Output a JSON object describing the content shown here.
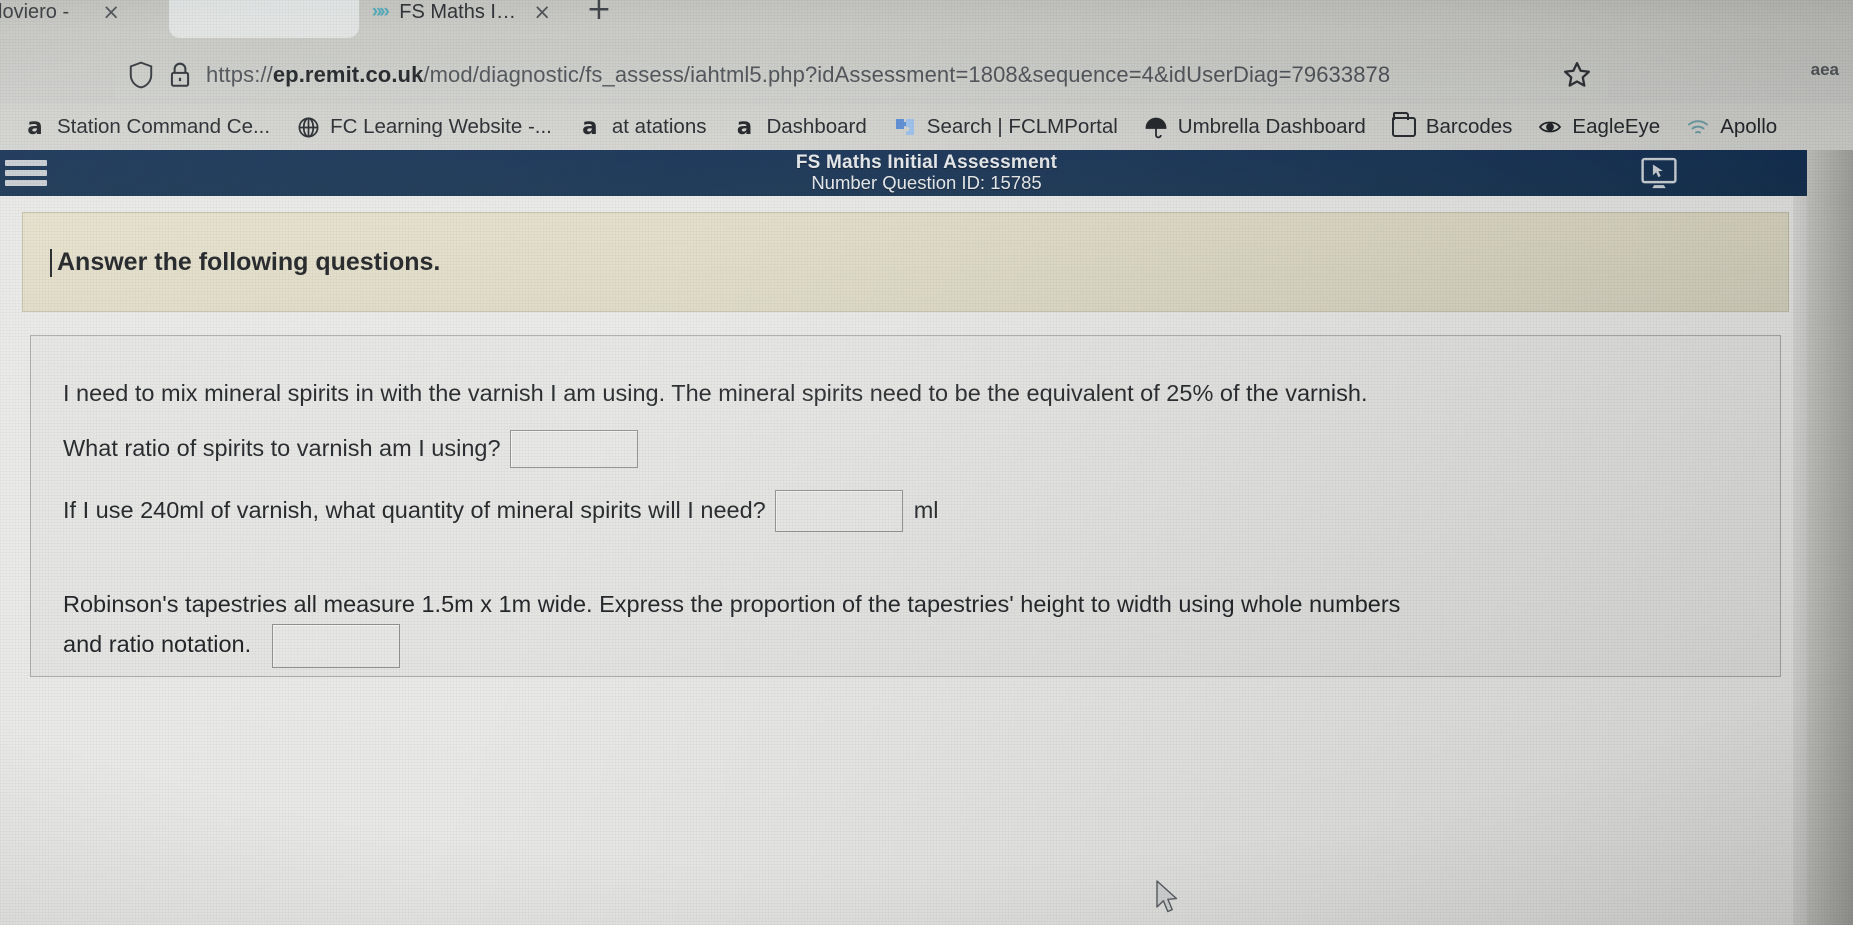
{
  "browser": {
    "tabs": [
      {
        "title": "loviero -",
        "close_label": "×",
        "favicon": ""
      },
      {
        "title": "FS Maths Initial Assessment",
        "close_label": "×",
        "favicon": "chevrons-icon"
      }
    ],
    "new_tab_label": "+",
    "window_controls": "—",
    "address": {
      "scheme": "https://",
      "host": "ep.remit.co.uk",
      "path": "/mod/diagnostic/fs_assess/",
      "file": "iahtml5.php?idAssessment=1808&sequence=4&idUserDiag=79633878",
      "full": "https://ep.remit.co.uk/mod/diagnostic/fs_assess/iahtml5.php?idAssessment=1808&sequence=4&idUserDiag=79633878",
      "shield_icon": "shield-icon",
      "lock_icon": "lock-warning-icon",
      "bookmark_icon": "star-icon"
    },
    "extension_badge": "aea",
    "bookmarks": [
      {
        "label": "Station Command Ce...",
        "icon": "amazon-icon"
      },
      {
        "label": "FC Learning Website -...",
        "icon": "globe-icon"
      },
      {
        "label": "at atations",
        "icon": "amazon-icon"
      },
      {
        "label": "Dashboard",
        "icon": "amazon-icon"
      },
      {
        "label": "Search | FCLMPortal",
        "icon": "puzzle-icon"
      },
      {
        "label": "Umbrella Dashboard",
        "icon": "umbrella-icon"
      },
      {
        "label": "Barcodes",
        "icon": "folder-icon"
      },
      {
        "label": "EagleEye",
        "icon": "eye-icon"
      },
      {
        "label": "Apollo",
        "icon": "wifi-icon"
      }
    ]
  },
  "app": {
    "menu_icon": "hamburger-icon",
    "title": "FS Maths Initial Assessment",
    "subtitle": "Number Question ID: 15785",
    "screen_icon": "monitor-cursor-icon",
    "instruction": "Answer the following questions."
  },
  "question": {
    "q1": {
      "intro": "I need to mix mineral spirits in with the varnish I am using. The mineral spirits need to be the equivalent of 25% of the varnish.",
      "part_a_prompt": "What ratio of spirits to varnish am I using?",
      "part_a_value": "",
      "part_b_prompt_before": "If I use 240ml of varnish, what quantity of mineral spirits will I need?",
      "part_b_value": "",
      "part_b_unit": "ml"
    },
    "q2": {
      "text_before": "Robinson's tapestries all measure 1.5m x 1m wide. Express the proportion of the tapestries' height to width using whole numbers and ratio notation.",
      "line1": "Robinson's tapestries all measure 1.5m x 1m wide. Express the proportion of the tapestries' height to width using whole numbers",
      "line2": "and ratio notation.",
      "value": ""
    }
  },
  "colors": {
    "header_blue": "#143055",
    "instruction_bg": "#e0dbc5",
    "card_bg": "#e4e4e2",
    "chrome_gray": "#cdcecb"
  }
}
